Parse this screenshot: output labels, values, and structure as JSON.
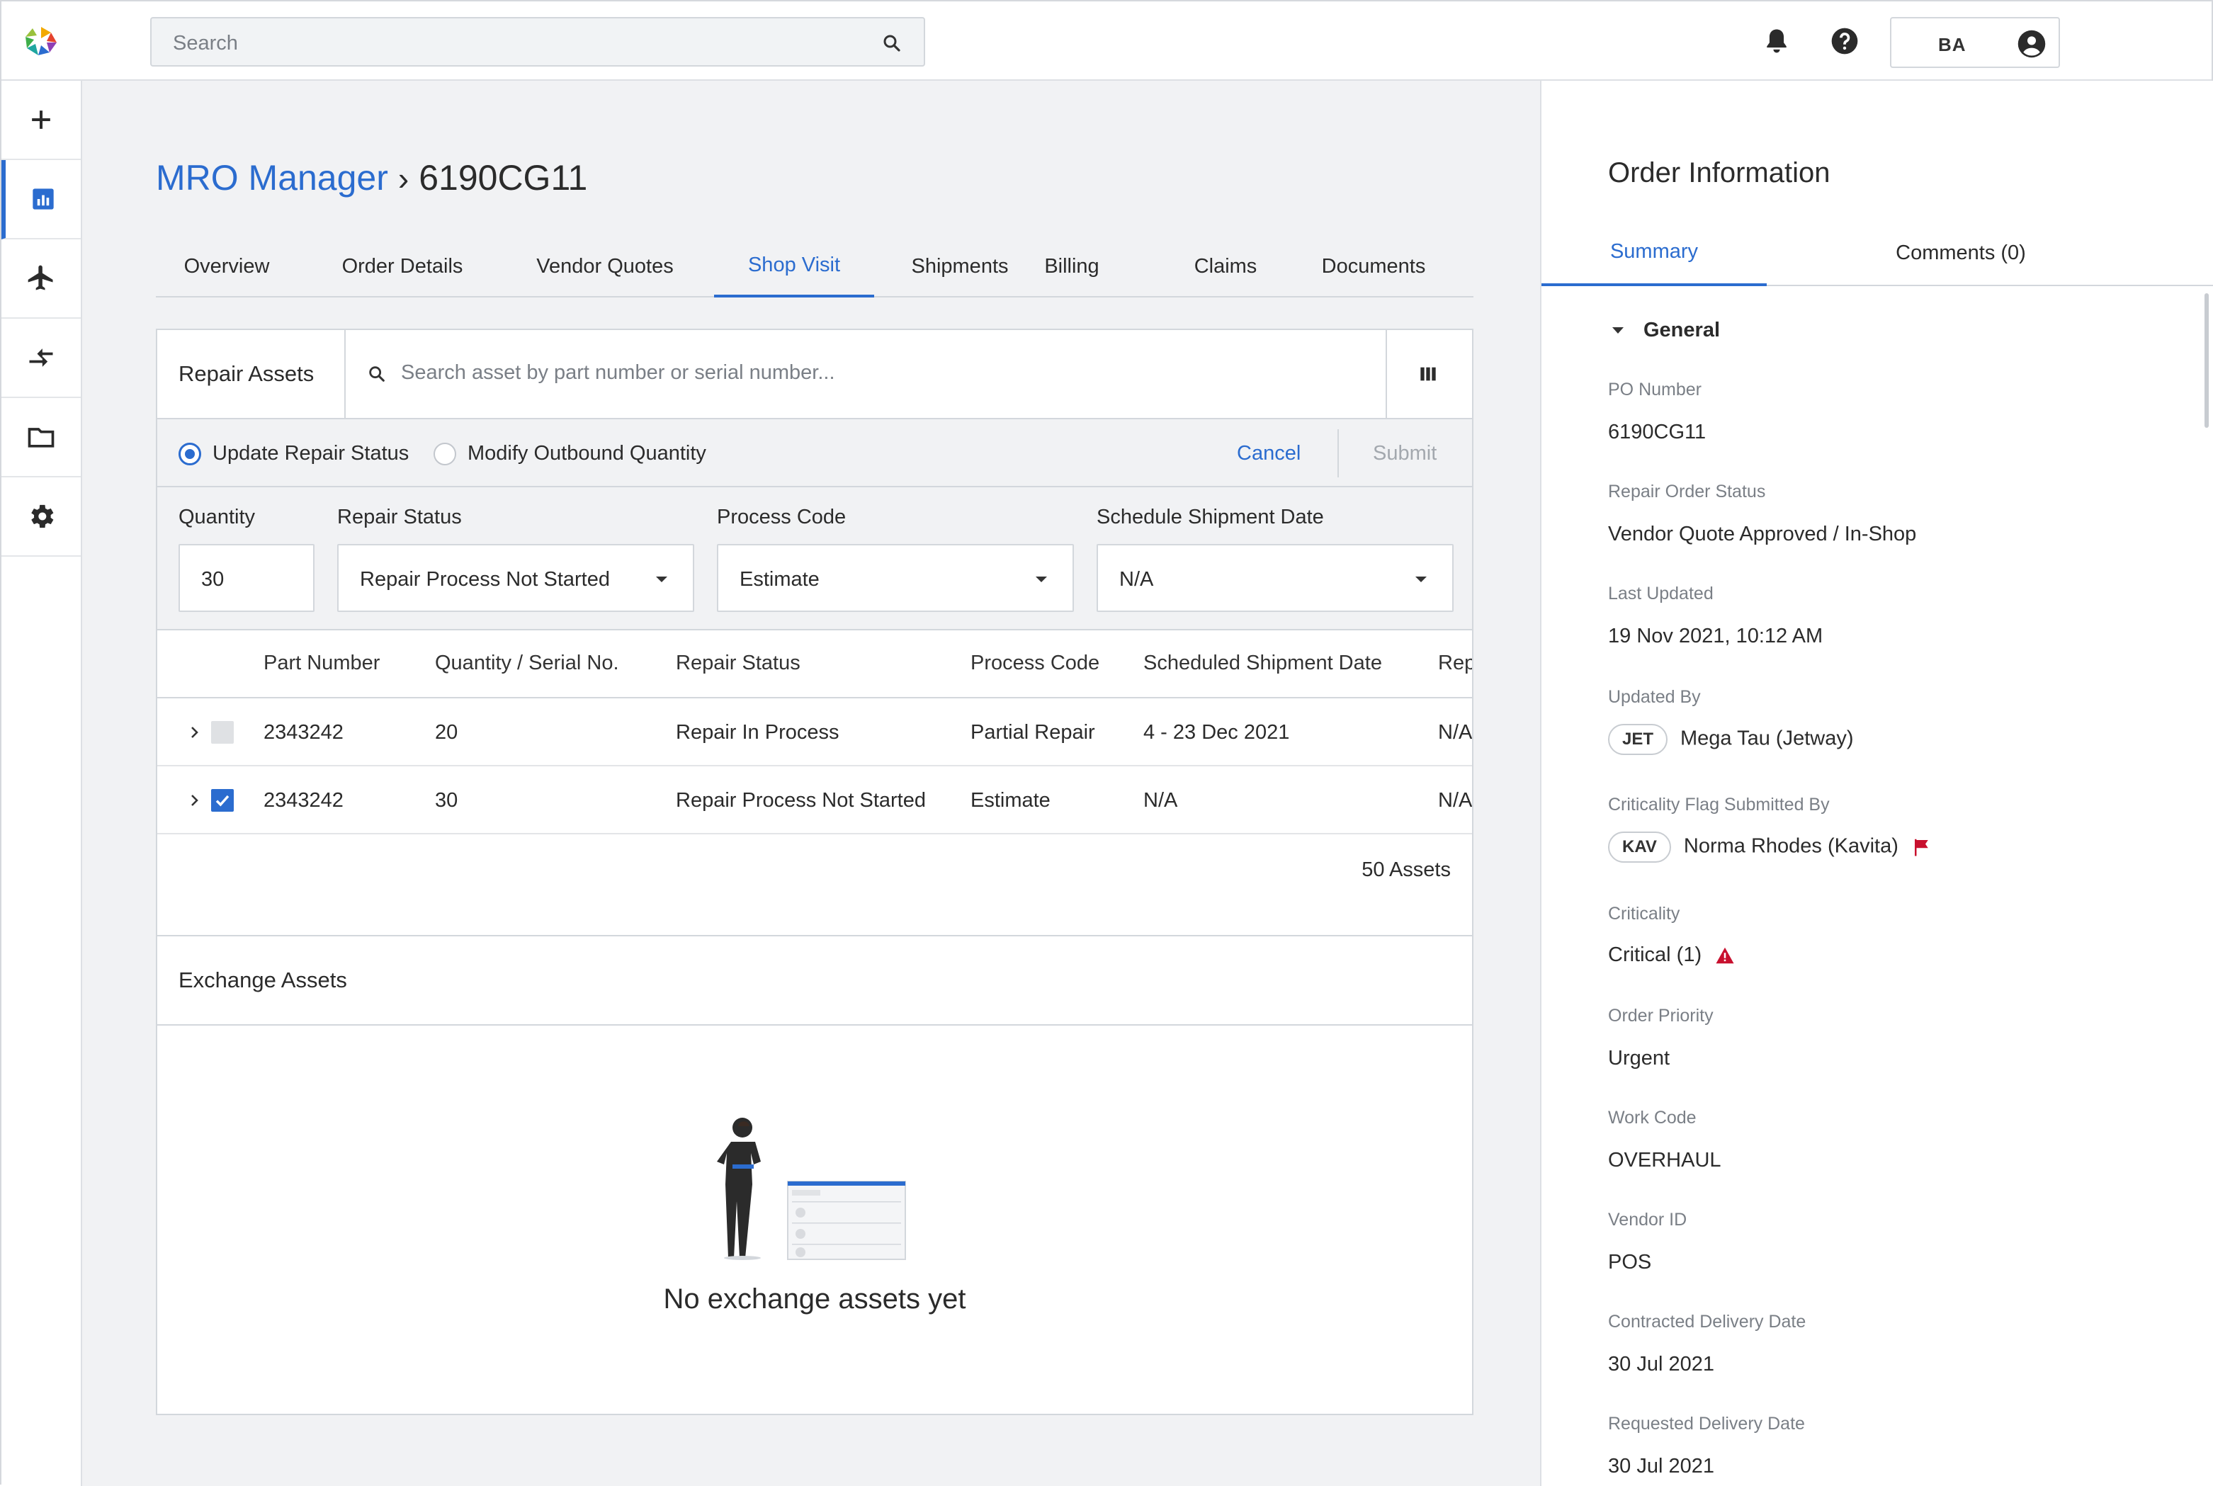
{
  "search": {
    "placeholder": "Search"
  },
  "user": {
    "initials": "BA"
  },
  "breadcrumb": {
    "app": "MRO Manager",
    "separator": "›",
    "current": "6190CG11"
  },
  "tabs": [
    {
      "label": "Overview"
    },
    {
      "label": "Order Details"
    },
    {
      "label": "Vendor Quotes"
    },
    {
      "label": "Shop Visit",
      "active": true
    },
    {
      "label": "Shipments"
    },
    {
      "label": "Billing"
    },
    {
      "label": "Claims"
    },
    {
      "label": "Documents"
    }
  ],
  "repair": {
    "title": "Repair Assets",
    "search_placeholder": "Search asset by part number or serial number...",
    "modes": {
      "update": "Update Repair Status",
      "modify": "Modify Outbound Quantity",
      "selected": "update"
    },
    "cancel": "Cancel",
    "submit": "Submit",
    "form": {
      "quantity": {
        "label": "Quantity",
        "value": "30"
      },
      "repair_status": {
        "label": "Repair Status",
        "value": "Repair Process Not Started"
      },
      "process_code": {
        "label": "Process Code",
        "value": "Estimate"
      },
      "shipment_date": {
        "label": "Schedule Shipment Date",
        "value": "N/A"
      }
    },
    "columns": [
      "Part Number",
      "Quantity / Serial No.",
      "Repair Status",
      "Process Code",
      "Scheduled Shipment Date",
      "Rep"
    ],
    "rows": [
      {
        "part": "2343242",
        "qty": "20",
        "status": "Repair In Process",
        "process": "Partial Repair",
        "date": "4 - 23 Dec 2021",
        "rep": "N/A",
        "checked": false
      },
      {
        "part": "2343242",
        "qty": "30",
        "status": "Repair Process Not Started",
        "process": "Estimate",
        "date": "N/A",
        "rep": "N/A",
        "checked": true
      }
    ],
    "count": "50 Assets"
  },
  "exchange": {
    "title": "Exchange Assets",
    "empty": "No exchange assets yet"
  },
  "order_info": {
    "title": "Order Information",
    "tabs": {
      "summary": "Summary",
      "comments": "Comments (0)"
    },
    "section": "General",
    "po_number": {
      "label": "PO Number",
      "value": "6190CG11"
    },
    "status": {
      "label": "Repair Order Status",
      "value": "Vendor Quote Approved / In-Shop"
    },
    "last_updated": {
      "label": "Last Updated",
      "value": "19 Nov 2021, 10:12 AM"
    },
    "updated_by": {
      "label": "Updated By",
      "tag": "JET",
      "value": "Mega Tau (Jetway)"
    },
    "criticality_by": {
      "label": "Criticality Flag Submitted By",
      "tag": "KAV",
      "value": "Norma Rhodes (Kavita)"
    },
    "criticality": {
      "label": "Criticality",
      "value": "Critical (1)"
    },
    "priority": {
      "label": "Order Priority",
      "value": "Urgent"
    },
    "work_code": {
      "label": "Work Code",
      "value": "OVERHAUL"
    },
    "vendor_id": {
      "label": "Vendor ID",
      "value": "POS"
    },
    "contracted": {
      "label": "Contracted Delivery Date",
      "value": "30 Jul 2021"
    },
    "requested": {
      "label": "Requested Delivery Date",
      "value": "30 Jul 2021"
    }
  },
  "colors": {
    "accent": "#2b6ccf",
    "alert": "#c8102e"
  }
}
